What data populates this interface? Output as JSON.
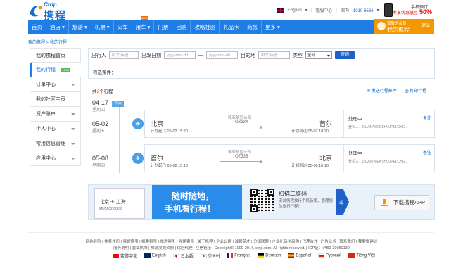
{
  "header": {
    "logo_brand": "Ctrip",
    "logo_cn": "携程",
    "language": "English",
    "service_center": "客服中心",
    "domestic_label": "国内：",
    "domestic_phone": "1010-6666",
    "app_promo_line1": "手机预订",
    "app_promo_line2": "专享优惠低至",
    "app_promo_pct": "50%",
    "colors": {
      "nav_blue": "#1e7ee6",
      "member_orange": "#f39800"
    }
  },
  "nav": {
    "items": [
      "首页",
      "酒店",
      "旅游",
      "机票",
      "火车",
      "用车",
      "门票",
      "团购",
      "攻略社区",
      "礼品卡",
      "商旅",
      "更多"
    ],
    "new_badge": "NEW"
  },
  "member": {
    "label": "尊敬的会员",
    "name": "我的携程",
    "logout": "退出"
  },
  "breadcrumb": "我的携程 > 我的行程",
  "sidebar": {
    "items": [
      {
        "label": "我的携程首页"
      },
      {
        "label": "我的行程",
        "badge": "NEW",
        "active": true
      },
      {
        "label": "订单中心"
      },
      {
        "label": "我的社区主页"
      },
      {
        "label": "资产账户"
      },
      {
        "label": "个人中心"
      },
      {
        "label": "常用信息管理"
      },
      {
        "label": "应用中心"
      }
    ]
  },
  "filter": {
    "traveler_label": "出行人",
    "traveler_placeholder": "中文/英语",
    "date_label": "出发日期",
    "date_from_placeholder": "yyyy-mm-dd",
    "date_sep": "—",
    "date_to_placeholder": "yyyy-mm-dd",
    "destination_label": "目的地",
    "destination_placeholder": "中文/英语",
    "type_label": "类型",
    "type_value": "全部",
    "query_button": "查询",
    "conditions_label": "筛选条件："
  },
  "trips": {
    "count_prefix": "共",
    "count": "2",
    "count_suffix": "个行程",
    "send_email": "发送行程邮件",
    "print": "打印行程",
    "today_badge": "今天",
    "groups": [
      {
        "date": "04-17",
        "weekday": "星期四"
      },
      {
        "date": "05-02",
        "weekday": "星期五",
        "trip": {
          "from": "北京",
          "to": "首尔",
          "airline": "韩亚航空公司",
          "flight": "OZ334",
          "dep_time": "计划起飞 05-02 15:20",
          "arr_time": "计划到达 05-02 18:20",
          "status": "处理中",
          "remark": "备注",
          "passenger": "登机人：DUAN/WENSHUJPEI/CHE..."
        }
      },
      {
        "date": "05-08",
        "weekday": "星期四",
        "trip": {
          "from": "首尔",
          "to": "北京",
          "airline": "韩亚航空公司",
          "flight": "OZ335",
          "dep_time": "计划起飞 05-08 15:10",
          "arr_time": "计划到达 05-08 16:10",
          "status": "处理中",
          "remark": "备注",
          "passenger": "登机人：DUAN/WENSHUJPEI/CHE..."
        }
      }
    ]
  },
  "banner": {
    "slogan1": "随时随地，",
    "slogan2": "手机看行程！",
    "phone_row1": "北京  ✈  上海",
    "phone_row2": "MU5102  08:00",
    "scan_title": "扫描二维码",
    "scan_desc": "安装携程旅行手机新版，管理您的旅行行程！",
    "arrow_text": "或",
    "download": "下载携程APP"
  },
  "footer": {
    "line1": "网站导航 | 免费注册 | 宾馆索引 | 机票索引 | 旅游索引 | 攻略索引 | 关于携程 | 企业公民 | 诚聘英才 | 分销联盟 | 企业礼品卡采购 | 代理合作 | 广告业务 | 联系我们 | 我要提建议",
    "line2": "服务说明 | 营业执照 | 旅游度假资质 | 保险代理 | 互信链接 | Copyright© 1999-2014, ctrip.com. All rights reserved. | ICP证：沪B2-20050130",
    "languages": [
      "繁體中文",
      "English",
      "日本語",
      "한국어",
      "Français",
      "Deutsch",
      "Español",
      "Русский",
      "Tiếng Việt"
    ]
  }
}
